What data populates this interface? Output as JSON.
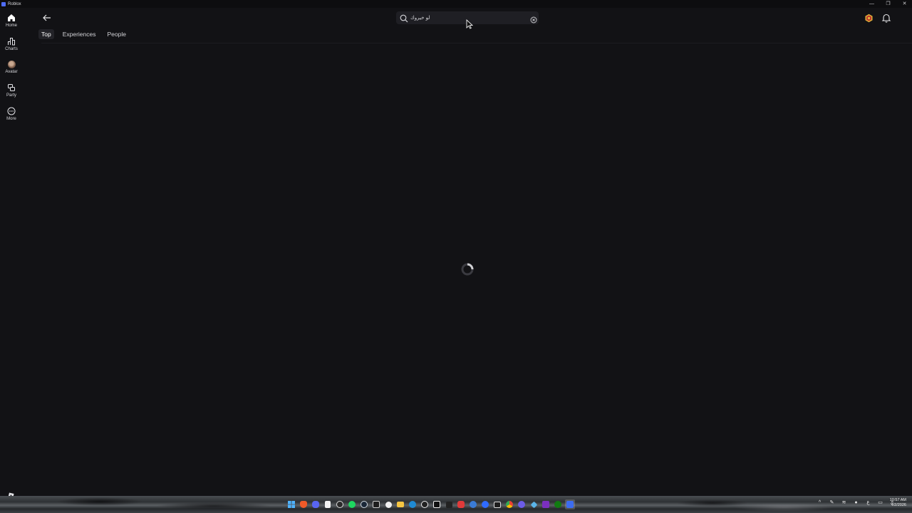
{
  "window": {
    "title": "Roblox"
  },
  "sidebar": {
    "items": [
      {
        "label": "Home",
        "icon": "home-icon"
      },
      {
        "label": "Charts",
        "icon": "charts-icon"
      },
      {
        "label": "Avatar",
        "icon": "avatar-icon"
      },
      {
        "label": "Party",
        "icon": "party-icon"
      },
      {
        "label": "More",
        "icon": "more-icon"
      }
    ]
  },
  "header": {
    "search": {
      "value": "لو خيروك"
    }
  },
  "tabs": [
    {
      "label": "Top",
      "active": true
    },
    {
      "label": "Experiences",
      "active": false
    },
    {
      "label": "People",
      "active": false
    }
  ],
  "colors": {
    "background": "#121215",
    "accent": "#4f6cf7",
    "tab_active_bg": "#232328"
  },
  "taskbar": {
    "language": "ع",
    "clock_time": "10:57 AM",
    "clock_date": "4/2/2026"
  }
}
